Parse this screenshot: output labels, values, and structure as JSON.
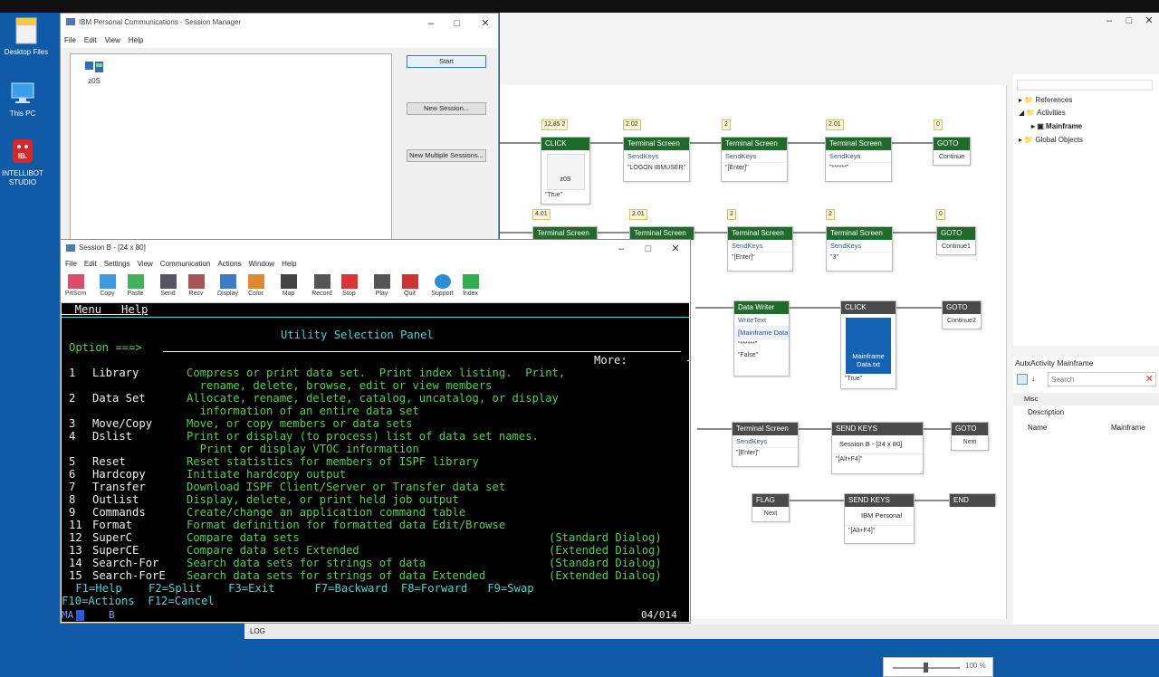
{
  "desktop": {
    "icons": [
      {
        "label": "Desktop Files",
        "icon": "folder-icon"
      },
      {
        "label": "This PC",
        "icon": "computer-icon"
      },
      {
        "label": "INTELLIBOT STUDIO",
        "icon": "robot-icon"
      }
    ]
  },
  "studio": {
    "nodes": {
      "n1": {
        "badge": "12,85  2",
        "head": "CLICK",
        "thumb": "z0S",
        "val": "\"True\""
      },
      "n2": {
        "badge": "2.02",
        "head": "Terminal Screen",
        "row": "SendKeys",
        "val": "\"LOGON IBMUSER\""
      },
      "n3": {
        "badge": "2",
        "head": "Terminal Screen",
        "row": "SendKeys",
        "val": "\"[Enter]\""
      },
      "n4": {
        "badge": "2.01",
        "head": "Terminal Screen",
        "row": "SendKeys",
        "val": "\"******\""
      },
      "n5": {
        "badge": "0",
        "head": "GOTO",
        "val": "Continue"
      },
      "n6": {
        "badge": "4.01",
        "head": "Terminal Screen"
      },
      "n7": {
        "badge": "2.01",
        "head": "Terminal Screen"
      },
      "n8": {
        "badge": "2",
        "head": "Terminal Screen",
        "row": "SendKeys",
        "val": "\"[Enter]\""
      },
      "n9": {
        "badge": "2",
        "head": "Terminal Screen",
        "row": "SendKeys",
        "val": "\"3\""
      },
      "n10": {
        "badge": "0",
        "head": "GOTO",
        "val": "Continue1"
      },
      "n11": {
        "head": "Data Writer",
        "row": "WriteText",
        "row2": "[Mainframe Data]",
        "val": "\"******\"",
        "val2": "\"False\""
      },
      "n12": {
        "head": "CLICK",
        "thumb": "Mainframe Data.txt",
        "val": "\"True\""
      },
      "n13": {
        "head": "GOTO",
        "val": "Continue2"
      },
      "n14": {
        "head": "Terminal Screen",
        "row": "SendKeys",
        "val": "\"[Enter]\""
      },
      "n15": {
        "head": "SEND KEYS",
        "row": "Session B - [24 x 80]",
        "val": "\"[Alt+F4]\""
      },
      "n16": {
        "head": "GOTO",
        "val": "Next"
      },
      "n17": {
        "head": "FLAG",
        "val": "Next"
      },
      "n18": {
        "head": "SEND KEYS",
        "row": "IBM Personal",
        "val": "\"[Alt+F4]\""
      },
      "n19": {
        "head": "END"
      }
    },
    "tree": {
      "items": [
        "References",
        "Activities",
        "Mainframe",
        "Global Objects"
      ]
    },
    "props": {
      "title": "AutxActivity",
      "subject": "Mainframe",
      "search_placeholder": "Search",
      "group": "Misc",
      "rows": [
        {
          "name": "Description",
          "value": ""
        },
        {
          "name": "Name",
          "value": "Mainframe"
        }
      ]
    },
    "zoom": "100 %",
    "log_label": "LOG"
  },
  "session_manager": {
    "title": "IBM Personal Communications - Session Manager",
    "menu": [
      "File",
      "Edit",
      "View",
      "Help"
    ],
    "session_label": "z0S",
    "buttons": {
      "start": "Start",
      "new_session": "New Session...",
      "new_multiple": "New Multiple Sessions..."
    }
  },
  "session_b": {
    "title": "Session B - [24 x 80]",
    "menu": [
      "File",
      "Edit",
      "Settings",
      "View",
      "Communication",
      "Actions",
      "Window",
      "Help"
    ],
    "toolbar": [
      "PrtScrn",
      "Copy",
      "Paste",
      "Send",
      "Recv",
      "Display",
      "Color",
      "Map",
      "Record",
      "Stop",
      "Play",
      "Quit",
      "Support",
      "Index"
    ],
    "terminal": {
      "menu_bar": "  Menu   Help",
      "title": "Utility Selection Panel",
      "option_prompt": "Option ===>",
      "more": "More:         +",
      "items": [
        {
          "num": "1 ",
          "name": "Library",
          "desc": "Compress or print data set.  Print index listing.  Print,",
          "desc2": "  rename, delete, browse, edit or view members"
        },
        {
          "num": "2 ",
          "name": "Data Set",
          "desc": "Allocate, rename, delete, catalog, uncatalog, or display",
          "desc2": "  information of an entire data set"
        },
        {
          "num": "3 ",
          "name": "Move/Copy",
          "desc": "Move, or copy members or data sets"
        },
        {
          "num": "4 ",
          "name": "Dslist",
          "desc": "Print or display (to process) list of data set names.",
          "desc2": "  Print or display VTOC information"
        },
        {
          "num": "5 ",
          "name": "Reset",
          "desc": "Reset statistics for members of ISPF library"
        },
        {
          "num": "6 ",
          "name": "Hardcopy",
          "desc": "Initiate hardcopy output"
        },
        {
          "num": "7 ",
          "name": "Transfer",
          "desc": "Download ISPF Client/Server or Transfer data set"
        },
        {
          "num": "8 ",
          "name": "Outlist",
          "desc": "Display, delete, or print held job output"
        },
        {
          "num": "9 ",
          "name": "Commands",
          "desc": "Create/change an application command table"
        },
        {
          "num": "11",
          "name": "Format",
          "desc": "Format definition for formatted data Edit/Browse"
        },
        {
          "num": "12",
          "name": "SuperC",
          "desc": "Compare data sets",
          "tag": "(Standard Dialog)"
        },
        {
          "num": "13",
          "name": "SuperCE",
          "desc": "Compare data sets Extended",
          "tag": "(Extended Dialog)"
        },
        {
          "num": "14",
          "name": "Search-For",
          "desc": "Search data sets for strings of data",
          "tag": "(Standard Dialog)"
        },
        {
          "num": "15",
          "name": "Search-ForE",
          "desc": "Search data sets for strings of data Extended",
          "tag": "(Extended Dialog)"
        }
      ],
      "pf_line1": " F1=Help    F2=Split    F3=Exit      F7=Backward  F8=Forward   F9=Swap",
      "pf_line2": "F10=Actions  F12=Cancel"
    },
    "oia_left": "MA",
    "oia_session": "B",
    "oia_cursor": "04/014"
  }
}
